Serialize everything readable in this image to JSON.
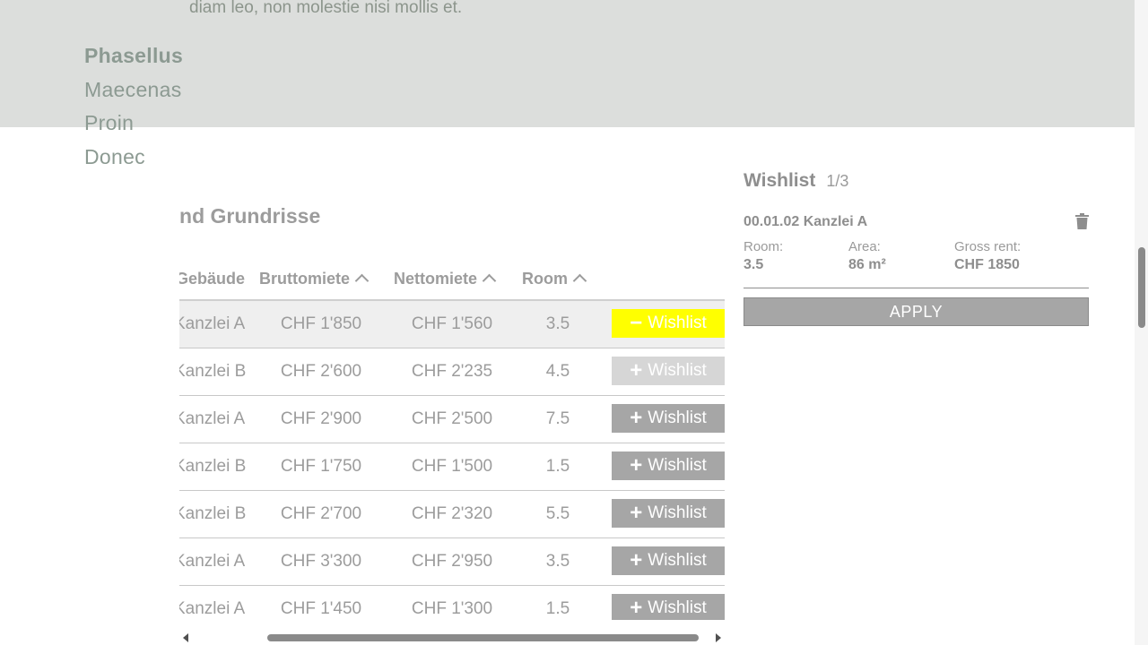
{
  "intro": {
    "text": "diam leo, non molestie nisi mollis et."
  },
  "nav": {
    "items": [
      {
        "label": "Phasellus"
      },
      {
        "label": "Maecenas"
      },
      {
        "label": "Proin"
      },
      {
        "label": "Donec"
      }
    ]
  },
  "section": {
    "title": "und Grundrisse"
  },
  "table": {
    "columns": [
      {
        "label": "Gebäude"
      },
      {
        "label": "Bruttomiete"
      },
      {
        "label": "Nettomiete"
      },
      {
        "label": "Room"
      }
    ],
    "rows": [
      {
        "name": "Kanzlei A",
        "brutto": "CHF 1'850",
        "netto": "CHF 1'560",
        "room": "3.5",
        "wishlist_label": "Wishlist",
        "wishlist_symbol": "−",
        "state": "added"
      },
      {
        "name": "Kanzlei B",
        "brutto": "CHF 2'600",
        "netto": "CHF 2'235",
        "room": "4.5",
        "wishlist_label": "Wishlist",
        "wishlist_symbol": "+",
        "state": "disabled"
      },
      {
        "name": "Kanzlei A",
        "brutto": "CHF 2'900",
        "netto": "CHF 2'500",
        "room": "7.5",
        "wishlist_label": "Wishlist",
        "wishlist_symbol": "+",
        "state": "normal"
      },
      {
        "name": "Kanzlei B",
        "brutto": "CHF 1'750",
        "netto": "CHF 1'500",
        "room": "1.5",
        "wishlist_label": "Wishlist",
        "wishlist_symbol": "+",
        "state": "normal"
      },
      {
        "name": "Kanzlei B",
        "brutto": "CHF 2'700",
        "netto": "CHF 2'320",
        "room": "5.5",
        "wishlist_label": "Wishlist",
        "wishlist_symbol": "+",
        "state": "normal"
      },
      {
        "name": "Kanzlei A",
        "brutto": "CHF 3'300",
        "netto": "CHF 2'950",
        "room": "3.5",
        "wishlist_label": "Wishlist",
        "wishlist_symbol": "+",
        "state": "normal"
      },
      {
        "name": "Kanzlei A",
        "brutto": "CHF 1'450",
        "netto": "CHF 1'300",
        "room": "1.5",
        "wishlist_label": "Wishlist",
        "wishlist_symbol": "+",
        "state": "normal"
      }
    ]
  },
  "wishlist": {
    "title": "Wishlist",
    "count": "1/3",
    "item": {
      "title": "00.01.02 Kanzlei A",
      "room_label": "Room:",
      "room_value": "3.5",
      "area_label": "Area:",
      "area_value": "86 m²",
      "rent_label": "Gross rent:",
      "rent_value": "CHF 1850"
    },
    "apply_label": "APPLY"
  },
  "colors": {
    "accent_added": "#ffff00",
    "button_grey": "#a6a6a6",
    "button_disabled": "#d6d6d6",
    "band_bg": "#dcdedc"
  },
  "icons": {
    "trash": "trash-icon",
    "sort": "chevron-up-icon"
  }
}
